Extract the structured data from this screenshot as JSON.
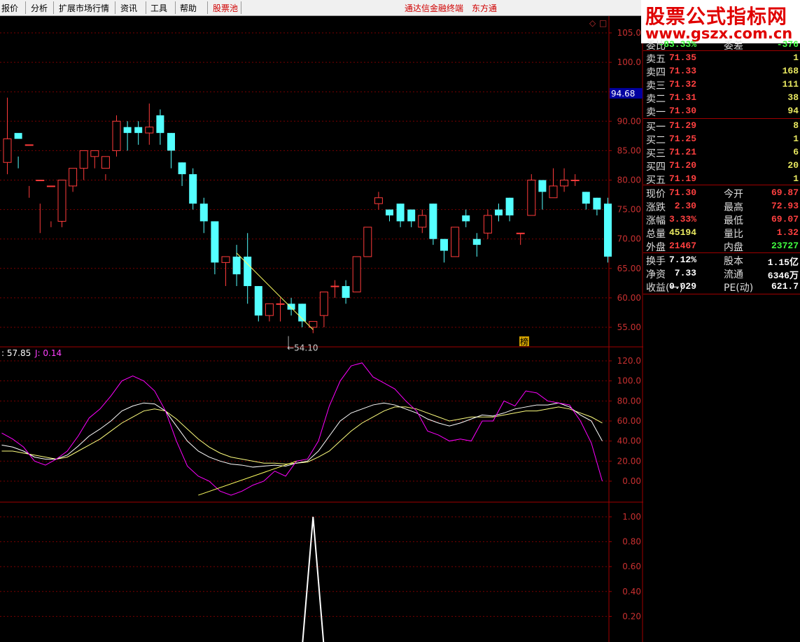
{
  "menu": {
    "items": [
      "报价",
      "分析",
      "扩展市场行情",
      "资讯",
      "工具",
      "帮助",
      "股票池"
    ],
    "center_links": [
      "通达信金融终端",
      "东方通"
    ]
  },
  "watermark": {
    "line1": "股票公式指标网",
    "line2": "www.gszx.com.cn"
  },
  "colors": {
    "up": "#ff3b3b",
    "down": "#54ffff",
    "k_line": "#ffffff",
    "d_line": "#ffff7f",
    "j_line": "#ff00ff",
    "signal": "#ffffff",
    "grid": "#7a0000"
  },
  "price_chart": {
    "ylabels": [
      "105.0",
      "100.0",
      "95.00",
      "90.00",
      "85.00",
      "80.00",
      "75.00",
      "70.00",
      "65.00",
      "60.00",
      "55.00"
    ],
    "current_price_tag": "94.68",
    "low_label": "54.10",
    "marker_char": "榜",
    "diamond": "◇",
    "box_icon": "□",
    "candles": [
      [
        83,
        87,
        81,
        94
      ],
      [
        88,
        87,
        82,
        84
      ],
      [
        86,
        86,
        77,
        79
      ],
      [
        80,
        80,
        71,
        76
      ],
      [
        79,
        79,
        72,
        73
      ],
      [
        73,
        80,
        72,
        79
      ],
      [
        79,
        82,
        78,
        82
      ],
      [
        82,
        85,
        80,
        85
      ],
      [
        84,
        85,
        82,
        85
      ],
      [
        82,
        84,
        80,
        81
      ],
      [
        85,
        90,
        84,
        91
      ],
      [
        89,
        88,
        85,
        90
      ],
      [
        89,
        88,
        86,
        90
      ],
      [
        88,
        89,
        86,
        93
      ],
      [
        91,
        88,
        86,
        92
      ],
      [
        88,
        85,
        82,
        88
      ],
      [
        83,
        81,
        79,
        83
      ],
      [
        81,
        76,
        75,
        82
      ],
      [
        76,
        73,
        71,
        77
      ],
      [
        73,
        66,
        64,
        73
      ],
      [
        66,
        67,
        62,
        67
      ],
      [
        67,
        64,
        62,
        69
      ],
      [
        67,
        62,
        59,
        71
      ],
      [
        62,
        57,
        56,
        62
      ],
      [
        57,
        59,
        56,
        59
      ],
      [
        59,
        59,
        56,
        60
      ],
      [
        59,
        58,
        57,
        60
      ],
      [
        59,
        56,
        55,
        59
      ],
      [
        55,
        56,
        54,
        56
      ],
      [
        57,
        61,
        55,
        61
      ],
      [
        62,
        62,
        60,
        63
      ],
      [
        62,
        60,
        59,
        63
      ],
      [
        61,
        67,
        61,
        67
      ],
      [
        67,
        72,
        67,
        72
      ],
      [
        76,
        77,
        75,
        78
      ],
      [
        75,
        74,
        73,
        75
      ],
      [
        76,
        73,
        72,
        76
      ],
      [
        75,
        73,
        72,
        75
      ],
      [
        72,
        74,
        71,
        75
      ],
      [
        76,
        70,
        69,
        76
      ],
      [
        70,
        68,
        66,
        70
      ],
      [
        67,
        72,
        67,
        72
      ],
      [
        74,
        73,
        72,
        75
      ],
      [
        70,
        69,
        67,
        71
      ],
      [
        71,
        74,
        70,
        75
      ],
      [
        75,
        74,
        73,
        76
      ],
      [
        77,
        74,
        73,
        77
      ],
      [
        71,
        71,
        69,
        71
      ],
      [
        74,
        80,
        74,
        81
      ],
      [
        80,
        78,
        75,
        80
      ],
      [
        77,
        79,
        77,
        82
      ],
      [
        79,
        80,
        78,
        82
      ],
      [
        80,
        80,
        79,
        81
      ],
      [
        78,
        76,
        75,
        78
      ],
      [
        77,
        75,
        74,
        77
      ],
      [
        76,
        67,
        66,
        77
      ]
    ]
  },
  "kdj_chart": {
    "header": ": 57.85",
    "j_label": "J: 0.14",
    "ylabels": [
      "120.0",
      "100.0",
      "80.00",
      "60.00",
      "40.00",
      "20.00",
      "0.00"
    ],
    "k": [
      36,
      34,
      30,
      24,
      22,
      22,
      26,
      35,
      45,
      52,
      60,
      70,
      75,
      78,
      77,
      70,
      55,
      40,
      30,
      24,
      20,
      17,
      16,
      14,
      15,
      16,
      15,
      18,
      20,
      30,
      45,
      60,
      68,
      72,
      76,
      78,
      76,
      72,
      68,
      62,
      58,
      55,
      58,
      62,
      66,
      65,
      68,
      72,
      74,
      76,
      76,
      78,
      74,
      66,
      60,
      40
    ],
    "d": [
      30,
      30,
      28,
      26,
      24,
      22,
      24,
      30,
      36,
      42,
      50,
      58,
      64,
      70,
      72,
      70,
      62,
      52,
      42,
      34,
      28,
      24,
      22,
      20,
      18,
      18,
      17,
      18,
      19,
      24,
      30,
      40,
      50,
      58,
      64,
      70,
      74,
      74,
      72,
      68,
      64,
      60,
      62,
      64,
      64,
      64,
      66,
      68,
      70,
      70,
      72,
      74,
      72,
      68,
      64,
      58
    ],
    "j": [
      48,
      42,
      34,
      20,
      16,
      22,
      30,
      45,
      63,
      72,
      85,
      100,
      105,
      100,
      90,
      70,
      40,
      15,
      5,
      0,
      -10,
      -14,
      -10,
      -4,
      0,
      10,
      5,
      20,
      22,
      40,
      75,
      100,
      115,
      118,
      104,
      98,
      92,
      80,
      70,
      50,
      46,
      40,
      42,
      40,
      60,
      60,
      80,
      75,
      90,
      88,
      80,
      78,
      76,
      60,
      38,
      0
    ],
    "trend": {
      "from_index": 18,
      "from_value": -14,
      "to_index": 27,
      "to_value": 20
    }
  },
  "signal_chart": {
    "ylabels": [
      "1.00",
      "0.80",
      "0.60",
      "0.40",
      "0.20"
    ],
    "spike_index": 28
  },
  "quote": {
    "top_row": {
      "label": "委比",
      "value": "-83.33%",
      "label2": "委差",
      "value2": "-376"
    },
    "sell": [
      {
        "label": "卖五",
        "price": "71.35",
        "vol": "1"
      },
      {
        "label": "卖四",
        "price": "71.33",
        "vol": "168"
      },
      {
        "label": "卖三",
        "price": "71.32",
        "vol": "111"
      },
      {
        "label": "卖二",
        "price": "71.31",
        "vol": "38"
      },
      {
        "label": "卖一",
        "price": "71.30",
        "vol": "94"
      }
    ],
    "buy": [
      {
        "label": "买一",
        "price": "71.29",
        "vol": "8"
      },
      {
        "label": "买二",
        "price": "71.25",
        "vol": "1"
      },
      {
        "label": "买三",
        "price": "71.21",
        "vol": "6"
      },
      {
        "label": "买四",
        "price": "71.20",
        "vol": "20"
      },
      {
        "label": "买五",
        "price": "71.19",
        "vol": "1"
      }
    ],
    "stats": [
      {
        "l1": "现价",
        "v1": "71.30",
        "c1": "red",
        "l2": "今开",
        "v2": "69.87",
        "c2": "red"
      },
      {
        "l1": "涨跌",
        "v1": "2.30",
        "c1": "red",
        "l2": "最高",
        "v2": "72.93",
        "c2": "red"
      },
      {
        "l1": "涨幅",
        "v1": "3.33%",
        "c1": "red",
        "l2": "最低",
        "v2": "69.07",
        "c2": "red"
      },
      {
        "l1": "总量",
        "v1": "45194",
        "c1": "yellow",
        "l2": "量比",
        "v2": "1.32",
        "c2": "red"
      },
      {
        "l1": "外盘",
        "v1": "21467",
        "c1": "red",
        "l2": "内盘",
        "v2": "23727",
        "c2": "green"
      }
    ],
    "info": [
      {
        "l1": "换手",
        "v1": "7.12%",
        "l2": "股本",
        "v2": "1.15亿"
      },
      {
        "l1": "净资",
        "v1": "7.33",
        "l2": "流通",
        "v2": "6346万"
      },
      {
        "l1": "收益(一)",
        "v1": "0.029",
        "l2": "PE(动)",
        "v2": "621.7"
      }
    ]
  }
}
